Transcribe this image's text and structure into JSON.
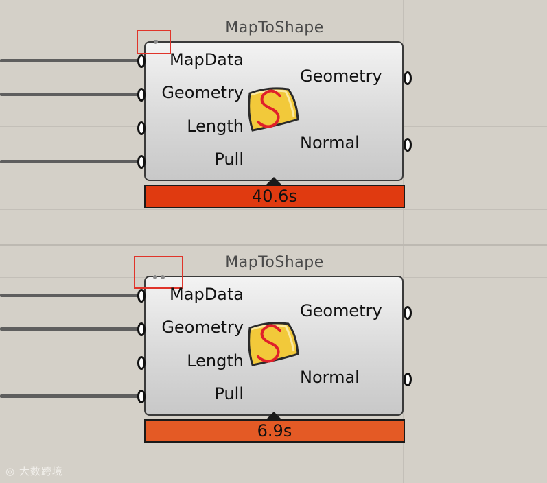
{
  "components": [
    {
      "title": "MapToShape",
      "inputs": [
        "MapData",
        "Geometry",
        "Length",
        "Pull"
      ],
      "outputs": [
        "Geometry",
        "Normal"
      ],
      "timer": "40.6s",
      "timer_color": "#e03a10"
    },
    {
      "title": "MapToShape",
      "inputs": [
        "MapData",
        "Geometry",
        "Length",
        "Pull"
      ],
      "outputs": [
        "Geometry",
        "Normal"
      ],
      "timer": "6.9s",
      "timer_color": "#e45a25"
    }
  ],
  "watermark": "大数跨境",
  "colors": {
    "canvas": "#d4d0c8",
    "highlight": "#e0342a",
    "icon_fill": "#f2c93a",
    "icon_stroke": "#e0202a"
  }
}
